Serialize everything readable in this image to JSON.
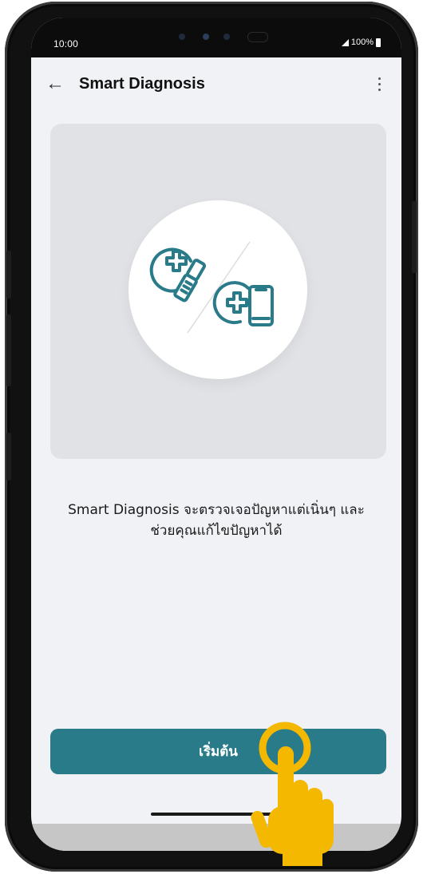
{
  "status_bar": {
    "time": "10:00",
    "battery": "100%",
    "signal_icon": "signal-icon",
    "battery_icon": "battery-icon"
  },
  "header": {
    "back_icon": "arrow-left-icon",
    "title": "Smart Diagnosis",
    "menu_icon": "more-vertical-icon"
  },
  "hero": {
    "illustration": "smart-diagnosis-phones-icon",
    "accent_color": "#2a7b8a"
  },
  "description": {
    "line1": "Smart Diagnosis จะตรวจเจอปัญหาแต่เนิ่นๆ และ",
    "line2": "ช่วยคุณแก้ไขปัญหาได้"
  },
  "footer": {
    "start_label": "เริ่มต้น"
  },
  "overlay": {
    "tap_hand_icon": "tap-hand-icon",
    "hand_color": "#f5b800"
  },
  "colors": {
    "background": "#f1f2f6",
    "card": "#e1e2e6",
    "button": "#2a7b8a"
  }
}
